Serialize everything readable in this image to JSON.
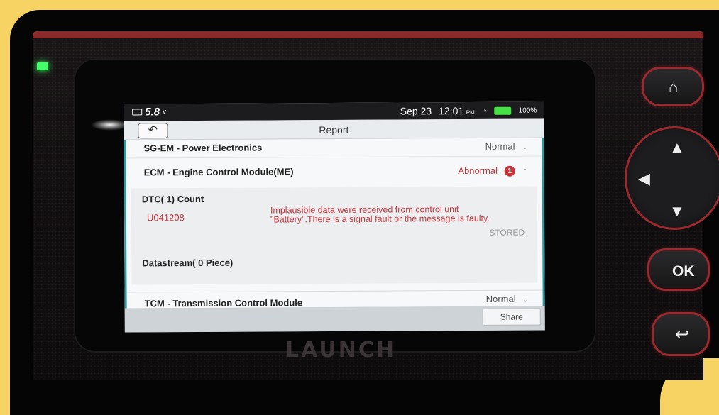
{
  "status_bar": {
    "voltage": "5.8",
    "voltage_unit": "v",
    "date": "Sep 23",
    "time": "12:01",
    "ampm": "PM",
    "battery": "100%",
    "battery_color": "#45e145"
  },
  "header": {
    "title": "Report",
    "back_icon": "back-arrow-icon"
  },
  "modules": [
    {
      "name": "SG-EM - Power Electronics",
      "status": "Normal"
    },
    {
      "name": "ECM - Engine Control Module(ME)",
      "status": "Abnormal",
      "dtc_badge": "1"
    },
    {
      "name": "TCM - Transmission Control Module",
      "status": "Normal"
    }
  ],
  "dtc": {
    "count_label": "DTC( 1) Count",
    "code": "U041208",
    "description": "Implausible data were received from control unit \"Battery\".There is a signal fault or the message is faulty.",
    "state": "STORED",
    "datastream_label": "Datastream( 0 Piece)"
  },
  "footer": {
    "share_label": "Share"
  },
  "hardware": {
    "brand": "LAUNCH",
    "ok_label": "OK",
    "accent_color": "#9a2a2f"
  }
}
